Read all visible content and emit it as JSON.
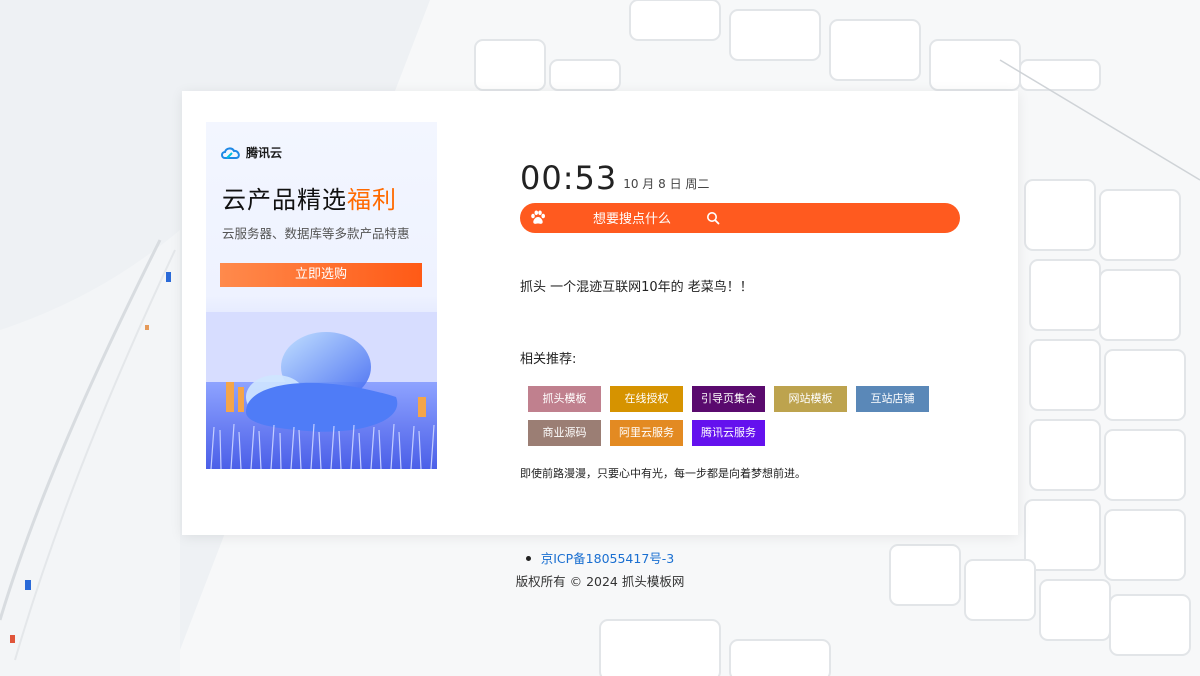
{
  "ad": {
    "logo_text": "腾讯云",
    "title_main": "云产品精选",
    "title_highlight": "福利",
    "subtitle": "云服务器、数据库等多款产品特惠",
    "button_label": "立即选购"
  },
  "clock": {
    "time": "00:53",
    "date": "10 月 8 日 周二"
  },
  "search": {
    "placeholder": "想要搜点什么"
  },
  "intro": "抓头 一个混迹互联网10年的 老菜鸟！！",
  "related_label": "相关推荐:",
  "tags": [
    {
      "label": "抓头模板",
      "color": "#c0808e"
    },
    {
      "label": "在线授权",
      "color": "#d69300"
    },
    {
      "label": "引导页集合",
      "color": "#5a0a6e"
    },
    {
      "label": "网站模板",
      "color": "#bda34e"
    },
    {
      "label": "互站店铺",
      "color": "#5a88b8"
    },
    {
      "label": "商业源码",
      "color": "#9b7e74"
    },
    {
      "label": "阿里云服务",
      "color": "#e38a22"
    },
    {
      "label": "腾讯云服务",
      "color": "#6411ee"
    }
  ],
  "motto": "即使前路漫漫，只要心中有光，每一步都是向着梦想前进。",
  "footer": {
    "icp": "京ICP备18055417号-3",
    "copyright": "版权所有 © 2024 抓头模板网"
  }
}
